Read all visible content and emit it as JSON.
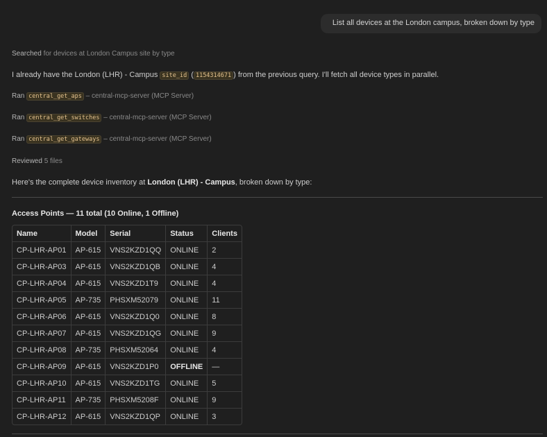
{
  "user_message": "List all devices at the London campus, broken down by type",
  "search_step": {
    "verb": "Searched",
    "detail": " for devices at London Campus site by type"
  },
  "intro": {
    "before": "I already have the London (LHR) - Campus ",
    "code1": "site_id",
    "middle": " (",
    "code2": "1154314671",
    "after": ") from the previous query. I'll fetch all device types in parallel."
  },
  "tool_calls": [
    {
      "verb": "Ran ",
      "tool": "central_get_aps",
      "server": " – central-mcp-server (MCP Server)"
    },
    {
      "verb": "Ran ",
      "tool": "central_get_switches",
      "server": " – central-mcp-server (MCP Server)"
    },
    {
      "verb": "Ran ",
      "tool": "central_get_gateways",
      "server": " – central-mcp-server (MCP Server)"
    }
  ],
  "review_step": {
    "verb": "Reviewed",
    "detail": " 5 files"
  },
  "summary": {
    "before": "Here's the complete device inventory at ",
    "bold": "London (LHR) - Campus",
    "after": ", broken down by type:"
  },
  "ap_section": {
    "title": "Access Points — 11 total (10 Online, 1 Offline)",
    "headers": [
      "Name",
      "Model",
      "Serial",
      "Status",
      "Clients"
    ],
    "rows": [
      [
        "CP-LHR-AP01",
        "AP-615",
        "VNS2KZD1QQ",
        "ONLINE",
        "2"
      ],
      [
        "CP-LHR-AP03",
        "AP-615",
        "VNS2KZD1QB",
        "ONLINE",
        "4"
      ],
      [
        "CP-LHR-AP04",
        "AP-615",
        "VNS2KZD1T9",
        "ONLINE",
        "4"
      ],
      [
        "CP-LHR-AP05",
        "AP-735",
        "PHSXM52079",
        "ONLINE",
        "11"
      ],
      [
        "CP-LHR-AP06",
        "AP-615",
        "VNS2KZD1Q0",
        "ONLINE",
        "8"
      ],
      [
        "CP-LHR-AP07",
        "AP-615",
        "VNS2KZD1QG",
        "ONLINE",
        "9"
      ],
      [
        "CP-LHR-AP08",
        "AP-735",
        "PHSXM52064",
        "ONLINE",
        "4"
      ],
      [
        "CP-LHR-AP09",
        "AP-615",
        "VNS2KZD1P0",
        "OFFLINE",
        "—"
      ],
      [
        "CP-LHR-AP10",
        "AP-615",
        "VNS2KZD1TG",
        "ONLINE",
        "5"
      ],
      [
        "CP-LHR-AP11",
        "AP-735",
        "PHSXM5208F",
        "ONLINE",
        "9"
      ],
      [
        "CP-LHR-AP12",
        "AP-615",
        "VNS2KZD1QP",
        "ONLINE",
        "3"
      ]
    ]
  }
}
